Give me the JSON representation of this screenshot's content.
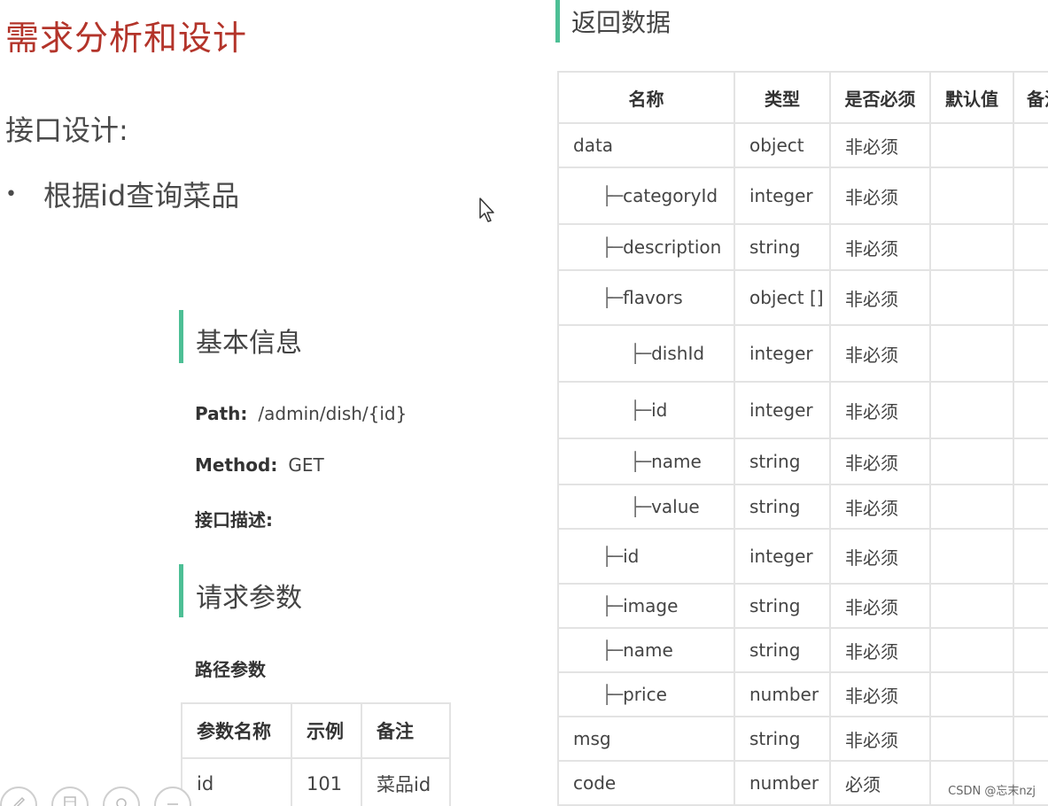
{
  "slide": {
    "title": "需求分析和设计",
    "subtitle": "接口设计:",
    "bullet": "根据id查询菜品"
  },
  "basic_info": {
    "heading": "基本信息",
    "path_label": "Path:",
    "path_value": "/admin/dish/{id}",
    "method_label": "Method:",
    "method_value": "GET",
    "desc_label": "接口描述:"
  },
  "request_params": {
    "heading": "请求参数",
    "path_params_heading": "路径参数",
    "columns": [
      "参数名称",
      "示例",
      "备注"
    ],
    "rows": [
      [
        "id",
        "101",
        "菜品id"
      ]
    ]
  },
  "response": {
    "heading": "返回数据",
    "columns": [
      "名称",
      "类型",
      "是否必须",
      "默认值",
      "备注"
    ],
    "rows": [
      {
        "indent": 0,
        "name": "data",
        "type": "object",
        "required": "非必须",
        "default": "",
        "note": ""
      },
      {
        "indent": 1,
        "name": "categoryId",
        "type": "integer",
        "required": "非必须",
        "default": "",
        "note": ""
      },
      {
        "indent": 1,
        "name": "description",
        "type": "string",
        "required": "非必须",
        "default": "",
        "note": ""
      },
      {
        "indent": 1,
        "name": "flavors",
        "type": "object []",
        "required": "非必须",
        "default": "",
        "note": ""
      },
      {
        "indent": 2,
        "name": "dishId",
        "type": "integer",
        "required": "非必须",
        "default": "",
        "note": ""
      },
      {
        "indent": 2,
        "name": "id",
        "type": "integer",
        "required": "非必须",
        "default": "",
        "note": ""
      },
      {
        "indent": 2,
        "name": "name",
        "type": "string",
        "required": "非必须",
        "default": "",
        "note": ""
      },
      {
        "indent": 2,
        "name": "value",
        "type": "string",
        "required": "非必须",
        "default": "",
        "note": ""
      },
      {
        "indent": 1,
        "name": "id",
        "type": "integer",
        "required": "非必须",
        "default": "",
        "note": ""
      },
      {
        "indent": 1,
        "name": "image",
        "type": "string",
        "required": "非必须",
        "default": "",
        "note": ""
      },
      {
        "indent": 1,
        "name": "name",
        "type": "string",
        "required": "非必须",
        "default": "",
        "note": ""
      },
      {
        "indent": 1,
        "name": "price",
        "type": "number",
        "required": "非必须",
        "default": "",
        "note": ""
      },
      {
        "indent": 0,
        "name": "msg",
        "type": "string",
        "required": "非必须",
        "default": "",
        "note": ""
      },
      {
        "indent": 0,
        "name": "code",
        "type": "number",
        "required": "必须",
        "default": "",
        "note": ""
      }
    ]
  },
  "toolbar": {
    "buttons": [
      "pen-icon",
      "grid-icon",
      "zoom-icon",
      "more-icon"
    ]
  },
  "watermark": "CSDN @忘末nzj",
  "colors": {
    "title": "#b3342a",
    "accent_bar": "#4dbf95",
    "border": "#e3e3e3"
  }
}
